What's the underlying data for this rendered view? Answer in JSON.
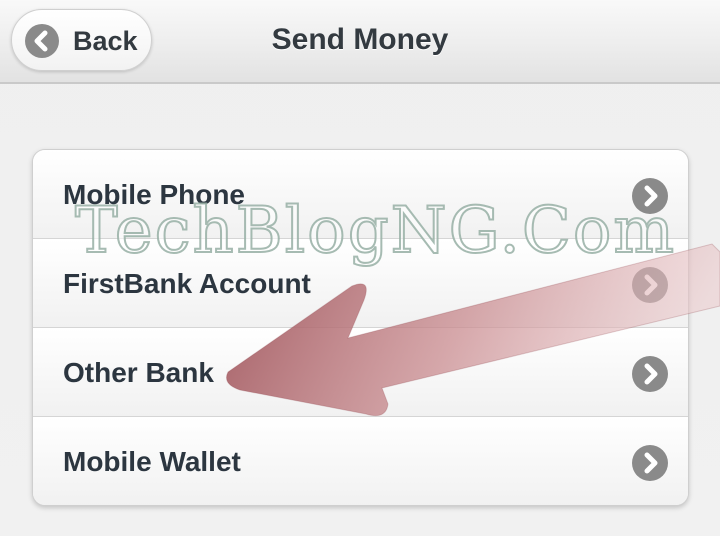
{
  "header": {
    "back_label": "Back",
    "title": "Send Money"
  },
  "menu": {
    "items": [
      {
        "label": "Mobile Phone",
        "chevron": "chevron-right-icon"
      },
      {
        "label": "FirstBank Account",
        "chevron": "chevron-right-icon"
      },
      {
        "label": "Other Bank",
        "chevron": "chevron-right-icon"
      },
      {
        "label": "Mobile Wallet",
        "chevron": "chevron-right-icon"
      }
    ]
  },
  "watermark": {
    "text": "TechBlogNG.Com"
  },
  "colors": {
    "text": "#2c3640",
    "icon_bg": "#8a8a8a",
    "annotation_arrow": "#a0565c"
  }
}
